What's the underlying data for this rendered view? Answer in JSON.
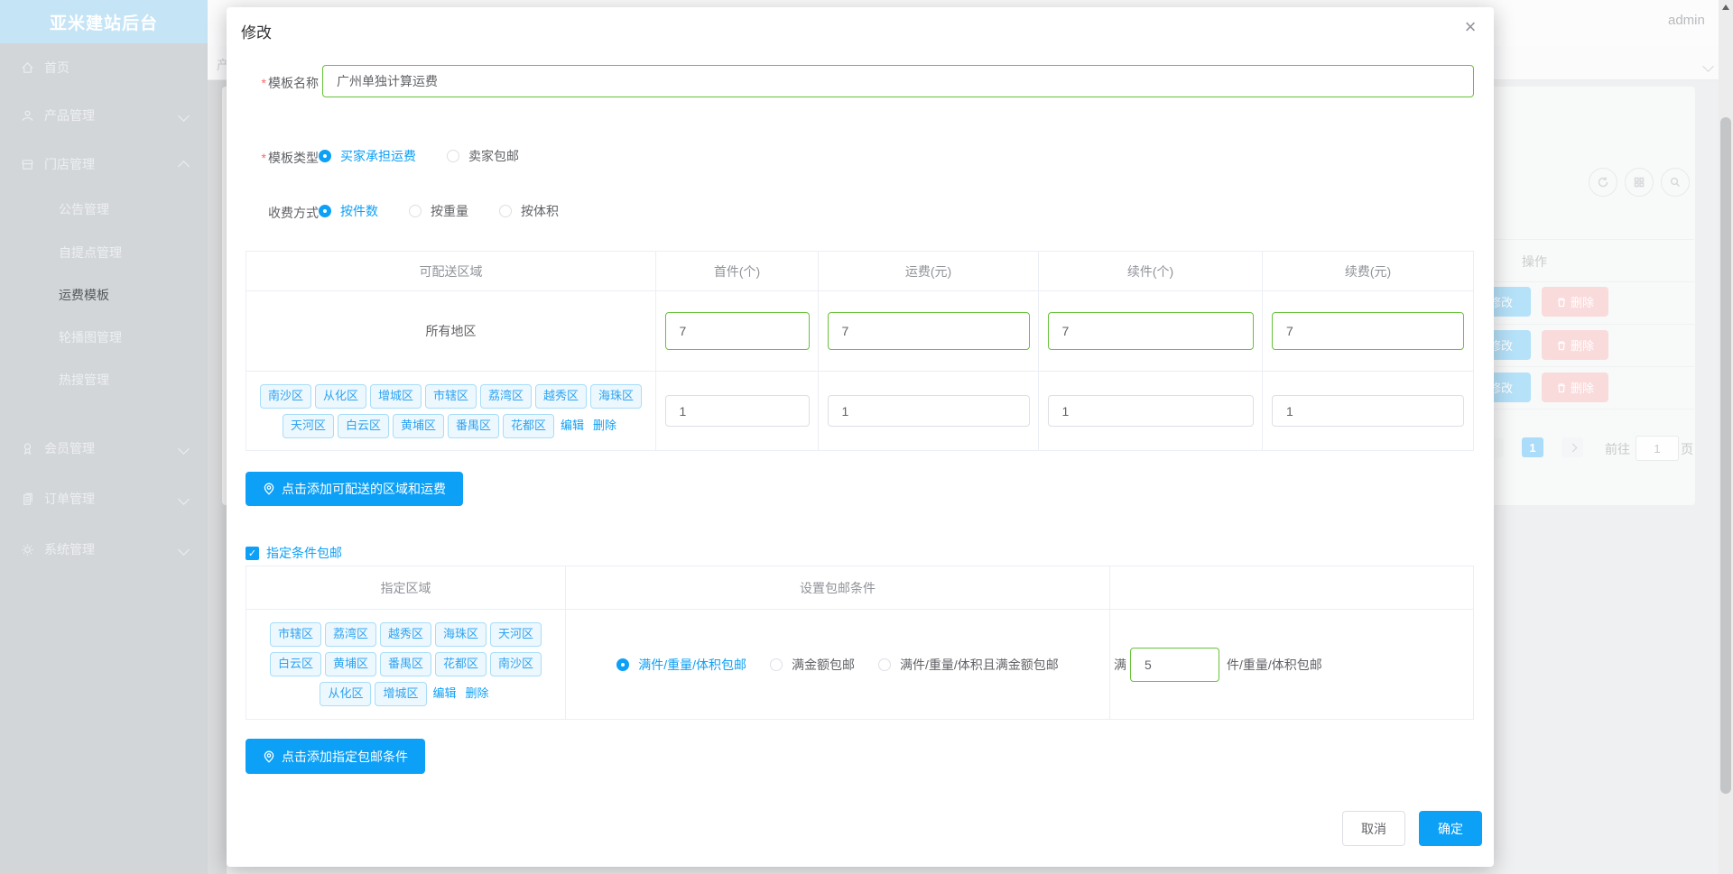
{
  "colors": {
    "primary": "#0da0f7",
    "success_border": "#67c23a",
    "danger": "#f56c6c",
    "tag_bg": "#ecf8fe",
    "tag_border": "#a8ddf8",
    "tag_text": "#2fa3f1"
  },
  "icons": {
    "close": "×",
    "check": "✓"
  },
  "app": {
    "brand": "亚米建站后台",
    "username": "admin",
    "partial_tab": "产"
  },
  "sidebar": {
    "items": [
      {
        "label": "首页"
      },
      {
        "label": "产品管理"
      },
      {
        "label": "门店管理"
      },
      {
        "label": "会员管理"
      },
      {
        "label": "订单管理"
      },
      {
        "label": "系统管理"
      }
    ],
    "submenu": [
      {
        "label": "公告管理"
      },
      {
        "label": "自提点管理"
      },
      {
        "label": "运费模板"
      },
      {
        "label": "轮播图管理"
      },
      {
        "label": "热搜管理"
      }
    ]
  },
  "background": {
    "action_header": "操作",
    "rows": [
      {
        "edit": "修改",
        "del": "删除"
      },
      {
        "edit": "修改",
        "del": "删除"
      },
      {
        "edit": "修改",
        "del": "删除"
      }
    ],
    "pagination": {
      "page": "1",
      "goto_label": "前往",
      "unit": "页",
      "goto_value": "1"
    }
  },
  "modal": {
    "title": "修改",
    "required_mark": "*",
    "name_field": {
      "label": "模板名称",
      "value": "广州单独计算运费"
    },
    "type_field": {
      "label": "模板类型",
      "options": [
        "买家承担运费",
        "卖家包邮"
      ],
      "selected": "买家承担运费"
    },
    "charge_field": {
      "label": "收费方式",
      "options": [
        "按件数",
        "按重量",
        "按体积"
      ],
      "selected": "按件数"
    },
    "shipping_table": {
      "headers": [
        "可配送区域",
        "首件(个)",
        "运费(元)",
        "续件(个)",
        "续费(元)"
      ],
      "row_all": {
        "region": "所有地区",
        "values": [
          "7",
          "7",
          "7",
          "7"
        ]
      },
      "row_custom": {
        "tags": [
          "南沙区",
          "从化区",
          "增城区",
          "市辖区",
          "荔湾区",
          "越秀区",
          "海珠区",
          "天河区",
          "白云区",
          "黄埔区",
          "番禺区",
          "花都区"
        ],
        "edit": "编辑",
        "del": "删除",
        "values": [
          "1",
          "1",
          "1",
          "1"
        ]
      }
    },
    "add_region_button": "点击添加可配送的区域和运费",
    "free_condition": {
      "label": "指定条件包邮",
      "checked": true
    },
    "condition_table": {
      "headers": [
        "指定区域",
        "设置包邮条件"
      ],
      "tags": [
        "市辖区",
        "荔湾区",
        "越秀区",
        "海珠区",
        "天河区",
        "白云区",
        "黄埔区",
        "番禺区",
        "花都区",
        "南沙区",
        "从化区",
        "增城区"
      ],
      "edit": "编辑",
      "del": "删除",
      "options": [
        "满件/重量/体积包邮",
        "满金额包邮",
        "满件/重量/体积且满金额包邮"
      ],
      "selected": "满件/重量/体积包邮",
      "prefix": "满",
      "value": "5",
      "suffix": "件/重量/体积包邮"
    },
    "add_condition_button": "点击添加指定包邮条件",
    "footer": {
      "cancel": "取消",
      "confirm": "确定"
    }
  }
}
